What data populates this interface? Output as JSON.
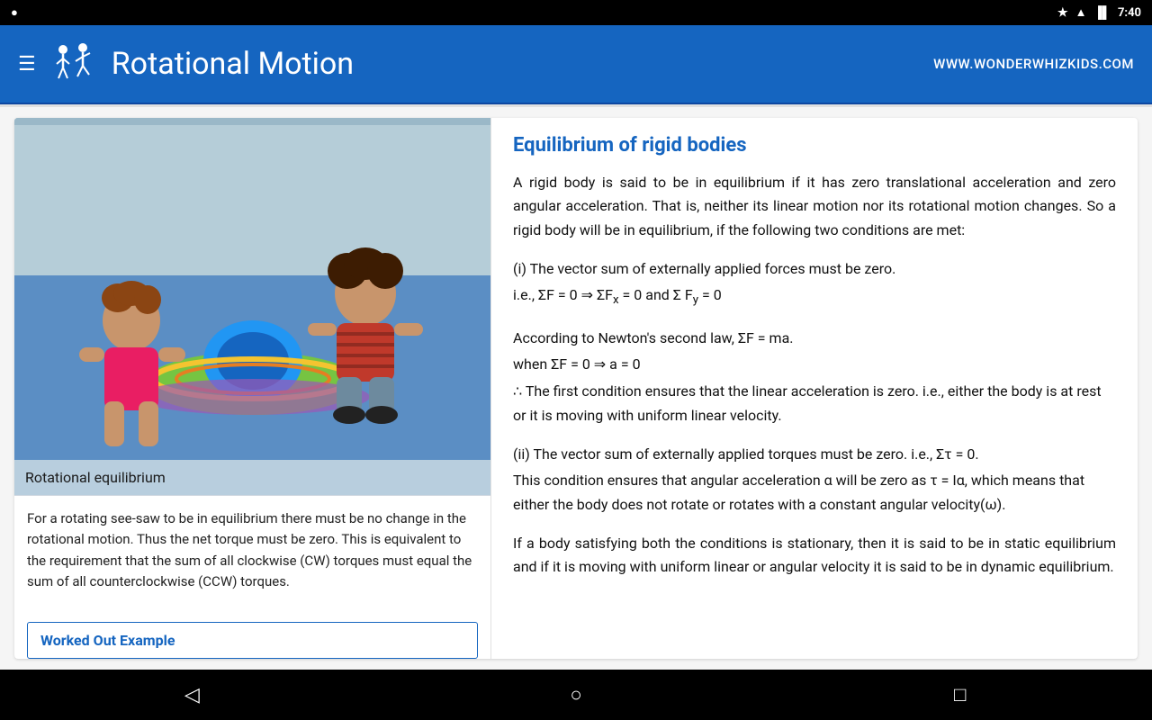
{
  "status_bar": {
    "left_icon": "●",
    "time": "7:40",
    "battery_icon": "🔋",
    "wifi_icon": "▲",
    "star_icon": "★"
  },
  "app_bar": {
    "title": "Rotational Motion",
    "website": "WWW.WONDERWHIZKIDS.COM"
  },
  "left_panel": {
    "image_caption": "Rotational equilibrium",
    "image_alt": "Two children on a rotational toy see-saw",
    "description": "For a rotating see-saw to be in equilibrium there must be no change in the rotational motion. Thus the net torque must be zero. This is equivalent to the requirement that the sum of all clockwise (CW) torques must equal the sum of all counterclockwise (CCW) torques.",
    "worked_example_label": "Worked Out Example"
  },
  "right_panel": {
    "section_title": "Equilibrium of rigid bodies",
    "paragraph1": "A rigid body is said to be in equilibrium if it has zero translational acceleration and zero angular acceleration. That is, neither its linear motion nor its rotational motion changes. So a rigid body will be in equilibrium, if the following two conditions are met:",
    "condition1_label": "(i) The vector sum of externally applied forces must be zero.",
    "condition1_math1": "i.e., ΣF = 0 ⇒ ΣFx = 0 and Σ Fy = 0",
    "newton_label": "According to Newton's second law, ΣF = ma.",
    "newton_math1": "when ΣF = 0 ⇒ a = 0",
    "newton_conclusion": "∴ The first condition ensures that the linear acceleration is zero. i.e., either the body is at rest or it is moving with uniform linear velocity.",
    "condition2_label": "(ii) The vector sum of externally applied torques must be zero. i.e., Στ = 0.",
    "condition2_detail": "This condition ensures that angular acceleration α will be zero as τ = Iα, which means that either the body does not rotate or rotates with a constant angular velocity(ω).",
    "paragraph_final": "If a body satisfying both the conditions is stationary, then it is said to be in static equilibrium and if it is moving with uniform linear or angular velocity it is said to be in dynamic equilibrium."
  },
  "bottom_nav": {
    "back_label": "◁",
    "home_label": "○",
    "recent_label": "□"
  }
}
